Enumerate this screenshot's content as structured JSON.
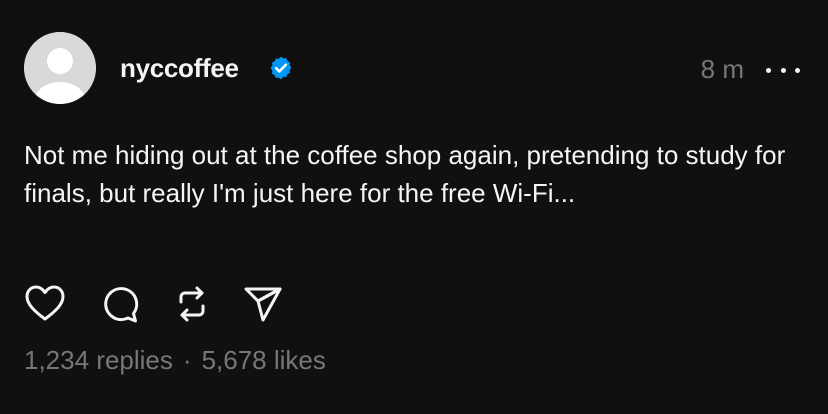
{
  "post": {
    "username": "nyccoffee",
    "time": "8 m",
    "text": "Not me hiding out at the coffee shop again, pretending to study for finals, but really I'm just here for the free Wi-Fi...",
    "replies": "1,234 replies",
    "separator": "·",
    "likes": "5,678 likes"
  },
  "icons": {
    "avatar": "default-avatar-icon",
    "verified": "verified-badge-icon",
    "more": "more-dots-icon",
    "like": "heart-icon",
    "reply": "comment-icon",
    "repost": "repost-icon",
    "share": "send-icon"
  },
  "colors": {
    "background": "#101010",
    "text": "#f3f5f7",
    "muted": "#777777",
    "verified": "#0095f6"
  }
}
